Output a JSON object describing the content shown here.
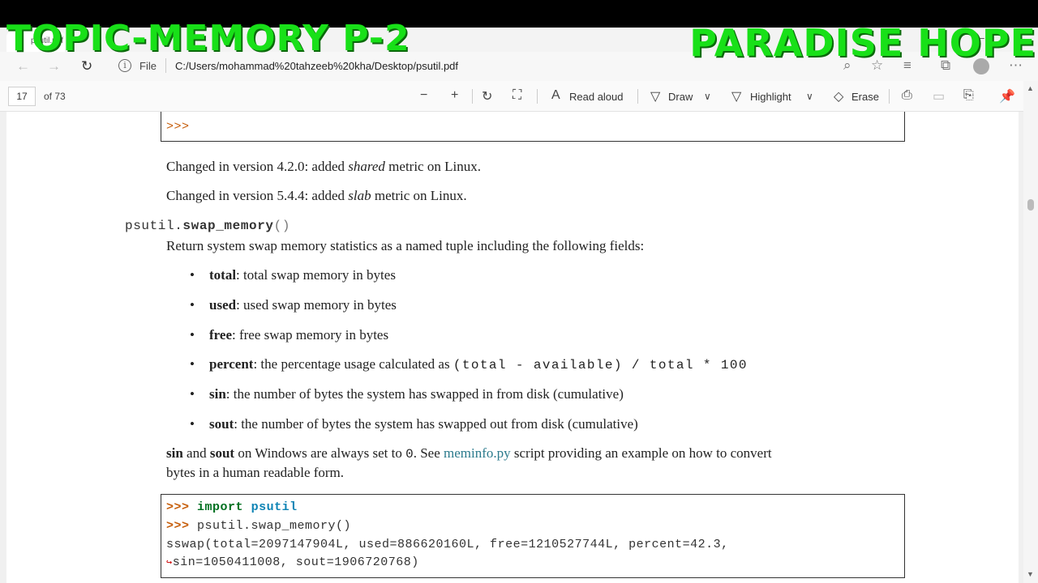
{
  "overlay": {
    "left": "TOPIC-MEMORY P-2",
    "right": "PARADISE HOPE"
  },
  "browser": {
    "tab_title": "psutil.pdf",
    "file_label": "File",
    "url": "C:/Users/mohammad%20tahzeeb%20kha/Desktop/psutil.pdf"
  },
  "pdf_toolbar": {
    "page_current": "17",
    "page_total": "of 73",
    "read_aloud": "Read aloud",
    "draw": "Draw",
    "highlight": "Highlight",
    "erase": "Erase"
  },
  "content": {
    "prev_prompt": ">>>",
    "changed_1": {
      "prefix": "Changed in version 4.2.0: added ",
      "em": "shared",
      "suffix": " metric on Linux."
    },
    "changed_2": {
      "prefix": "Changed in version 5.4.4: added ",
      "em": "slab",
      "suffix": " metric on Linux."
    },
    "fn": {
      "module": "psutil.",
      "name": "swap_memory",
      "parens": "()"
    },
    "desc": "Return system swap memory statistics as a named tuple including the following fields:",
    "bullets": [
      {
        "term": "total",
        "text": ": total swap memory in bytes"
      },
      {
        "term": "used",
        "text": ": used swap memory in bytes"
      },
      {
        "term": "free",
        "text": ": free swap memory in bytes"
      },
      {
        "term": "percent",
        "text": ": the percentage usage calculated as ",
        "code": "(total - available) / total * 100"
      },
      {
        "term": "sin",
        "text": ": the number of bytes the system has swapped in from disk (cumulative)"
      },
      {
        "term": "sout",
        "text": ": the number of bytes the system has swapped out from disk (cumulative)"
      }
    ],
    "note": {
      "t1": "sin",
      "and": " and ",
      "t2": "sout",
      "mid": " on Windows are always set to ",
      "zero": "0",
      "see": ". See ",
      "link": "meminfo.py",
      "rest": " script providing an example on how to convert",
      "line2": "bytes in a human readable form."
    },
    "code": {
      "p1": ">>>",
      "kw_import": "import",
      "module": "psutil",
      "p2": ">>>",
      "call": "psutil.swap_memory()",
      "out1": "sswap(total=2097147904L, used=886620160L, free=1210527744L, percent=42.3,",
      "cont": "↪",
      "out2": "sin=1050411008, sout=1906720768)"
    }
  }
}
